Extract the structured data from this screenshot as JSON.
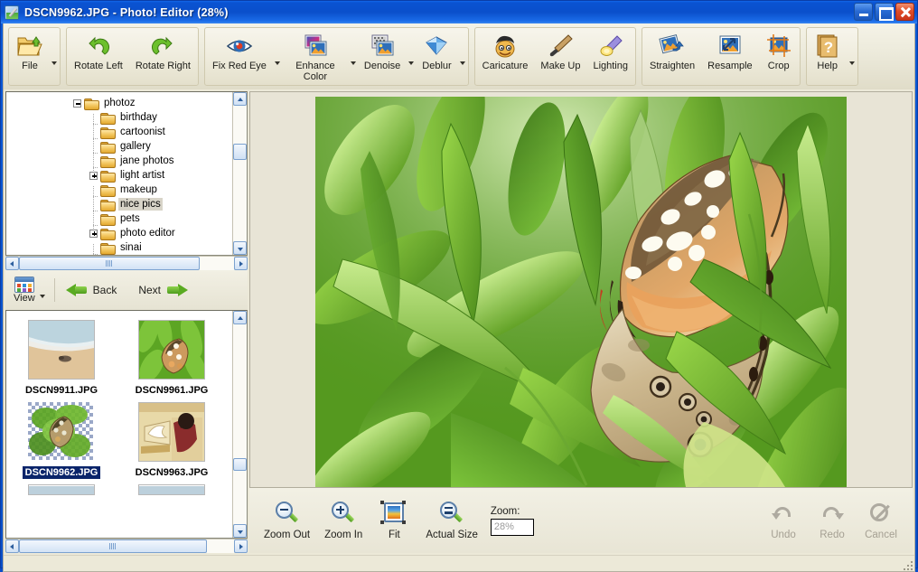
{
  "window": {
    "title": "DSCN9962.JPG - Photo! Editor (28%)",
    "icon": "photo-editor-icon",
    "buttons": {
      "minimize": "Minimize",
      "maximize": "Maximize",
      "close": "Close"
    }
  },
  "toolbar": {
    "groups": [
      {
        "name": "file-group",
        "buttons": [
          {
            "label": "File",
            "icon": "open-folder-icon",
            "dropdown": true,
            "two_line": false
          }
        ]
      },
      {
        "name": "rotate-group",
        "buttons": [
          {
            "label": "Rotate Left",
            "icon": "rotate-left-icon",
            "dropdown": false,
            "two_line": false
          },
          {
            "label": "Rotate Right",
            "icon": "rotate-right-icon",
            "dropdown": false,
            "two_line": false
          }
        ]
      },
      {
        "name": "enhance-group",
        "buttons": [
          {
            "label": "Fix Red Eye",
            "icon": "red-eye-icon",
            "dropdown": true,
            "two_line": false
          },
          {
            "label": "Enhance Color",
            "icon": "enhance-color-icon",
            "dropdown": true,
            "two_line": true
          },
          {
            "label": "Denoise",
            "icon": "denoise-icon",
            "dropdown": true,
            "two_line": false
          },
          {
            "label": "Deblur",
            "icon": "deblur-icon",
            "dropdown": true,
            "two_line": false
          }
        ]
      },
      {
        "name": "effects-group",
        "buttons": [
          {
            "label": "Caricature",
            "icon": "caricature-icon",
            "dropdown": false,
            "two_line": false
          },
          {
            "label": "Make Up",
            "icon": "makeup-brush-icon",
            "dropdown": false,
            "two_line": false
          },
          {
            "label": "Lighting",
            "icon": "lighting-lamp-icon",
            "dropdown": false,
            "two_line": false
          }
        ]
      },
      {
        "name": "geometry-group",
        "buttons": [
          {
            "label": "Straighten",
            "icon": "straighten-icon",
            "dropdown": false,
            "two_line": false
          },
          {
            "label": "Resample",
            "icon": "resample-icon",
            "dropdown": false,
            "two_line": false
          },
          {
            "label": "Crop",
            "icon": "crop-icon",
            "dropdown": false,
            "two_line": false
          }
        ]
      },
      {
        "name": "help-group",
        "buttons": [
          {
            "label": "Help",
            "icon": "help-question-icon",
            "dropdown": true,
            "two_line": false
          }
        ]
      }
    ]
  },
  "tree": {
    "nodes": [
      {
        "label": "photoz",
        "depth": 0,
        "expander": "minus",
        "highlighted": false
      },
      {
        "label": "birthday",
        "depth": 1,
        "expander": "none",
        "highlighted": false
      },
      {
        "label": "cartoonist",
        "depth": 1,
        "expander": "none",
        "highlighted": false
      },
      {
        "label": "gallery",
        "depth": 1,
        "expander": "none",
        "highlighted": false
      },
      {
        "label": "jane photos",
        "depth": 1,
        "expander": "none",
        "highlighted": false
      },
      {
        "label": "light artist",
        "depth": 1,
        "expander": "plus",
        "highlighted": false
      },
      {
        "label": "makeup",
        "depth": 1,
        "expander": "none",
        "highlighted": false
      },
      {
        "label": "nice pics",
        "depth": 1,
        "expander": "none",
        "highlighted": true
      },
      {
        "label": "pets",
        "depth": 1,
        "expander": "none",
        "highlighted": false
      },
      {
        "label": "photo editor",
        "depth": 1,
        "expander": "plus",
        "highlighted": false
      },
      {
        "label": "sinai",
        "depth": 1,
        "expander": "none",
        "highlighted": false
      }
    ]
  },
  "nav": {
    "view_label": "View",
    "view_icon": "grid-view-icon",
    "back_label": "Back",
    "back_icon": "left-arrow-icon",
    "next_label": "Next",
    "next_icon": "right-arrow-icon"
  },
  "thumbnails": {
    "items": [
      {
        "name": "DSCN9911.JPG",
        "selected": false,
        "style": "beach"
      },
      {
        "name": "DSCN9961.JPG",
        "selected": false,
        "style": "butterfly"
      },
      {
        "name": "DSCN9962.JPG",
        "selected": true,
        "style": "butterfly-alpha"
      },
      {
        "name": "DSCN9963.JPG",
        "selected": false,
        "style": "egypt"
      }
    ]
  },
  "canvas": {
    "image_name": "DSCN9962.JPG",
    "description": "Painted lady butterfly resting on green leaves"
  },
  "bottombar": {
    "zoom_out": {
      "label": "Zoom Out",
      "icon": "magnifier-minus-icon",
      "enabled": true
    },
    "zoom_in": {
      "label": "Zoom In",
      "icon": "magnifier-plus-icon",
      "enabled": true
    },
    "fit": {
      "label": "Fit",
      "icon": "fit-to-window-icon",
      "enabled": true
    },
    "actual_size": {
      "label": "Actual Size",
      "icon": "magnifier-equal-icon",
      "enabled": true
    },
    "zoom_label": "Zoom:",
    "zoom_value": "28%",
    "undo": {
      "label": "Undo",
      "icon": "undo-arrow-icon",
      "enabled": false
    },
    "redo": {
      "label": "Redo",
      "icon": "redo-arrow-icon",
      "enabled": false
    },
    "cancel": {
      "label": "Cancel",
      "icon": "cancel-circle-icon",
      "enabled": false
    }
  },
  "colors": {
    "title_blue": "#0a50c8",
    "toolbar_bg": "#efecdd",
    "canvas_bg": "#e8e4d6",
    "selection_blue": "#0a246a",
    "tree_highlight": "#d8d4c8"
  }
}
